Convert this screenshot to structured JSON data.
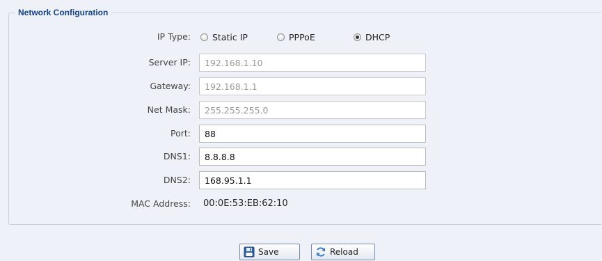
{
  "section": {
    "title": "Network Configuration"
  },
  "ip_type": {
    "label": "IP Type:",
    "options": [
      {
        "label": "Static IP",
        "checked": false
      },
      {
        "label": "PPPoE",
        "checked": false
      },
      {
        "label": "DHCP",
        "checked": true
      }
    ]
  },
  "fields": {
    "server_ip": {
      "label": "Server IP:",
      "value": "192.168.1.10",
      "disabled": true
    },
    "gateway": {
      "label": "Gateway:",
      "value": "192.168.1.1",
      "disabled": true
    },
    "net_mask": {
      "label": "Net Mask:",
      "value": "255.255.255.0",
      "disabled": true
    },
    "port": {
      "label": "Port:",
      "value": "88",
      "disabled": false
    },
    "dns1": {
      "label": "DNS1:",
      "value": "8.8.8.8",
      "disabled": false
    },
    "dns2": {
      "label": "DNS2:",
      "value": "168.95.1.1",
      "disabled": false
    }
  },
  "mac": {
    "label": "MAC Address:",
    "value": "00:0E:53:EB:62:10"
  },
  "buttons": {
    "save": {
      "label": "Save",
      "icon": "floppy-disk-icon"
    },
    "reload": {
      "label": "Reload",
      "icon": "refresh-icon"
    }
  },
  "colors": {
    "background": "#eef2f8",
    "legend_text": "#15428b",
    "border": "#c5cfdf"
  }
}
